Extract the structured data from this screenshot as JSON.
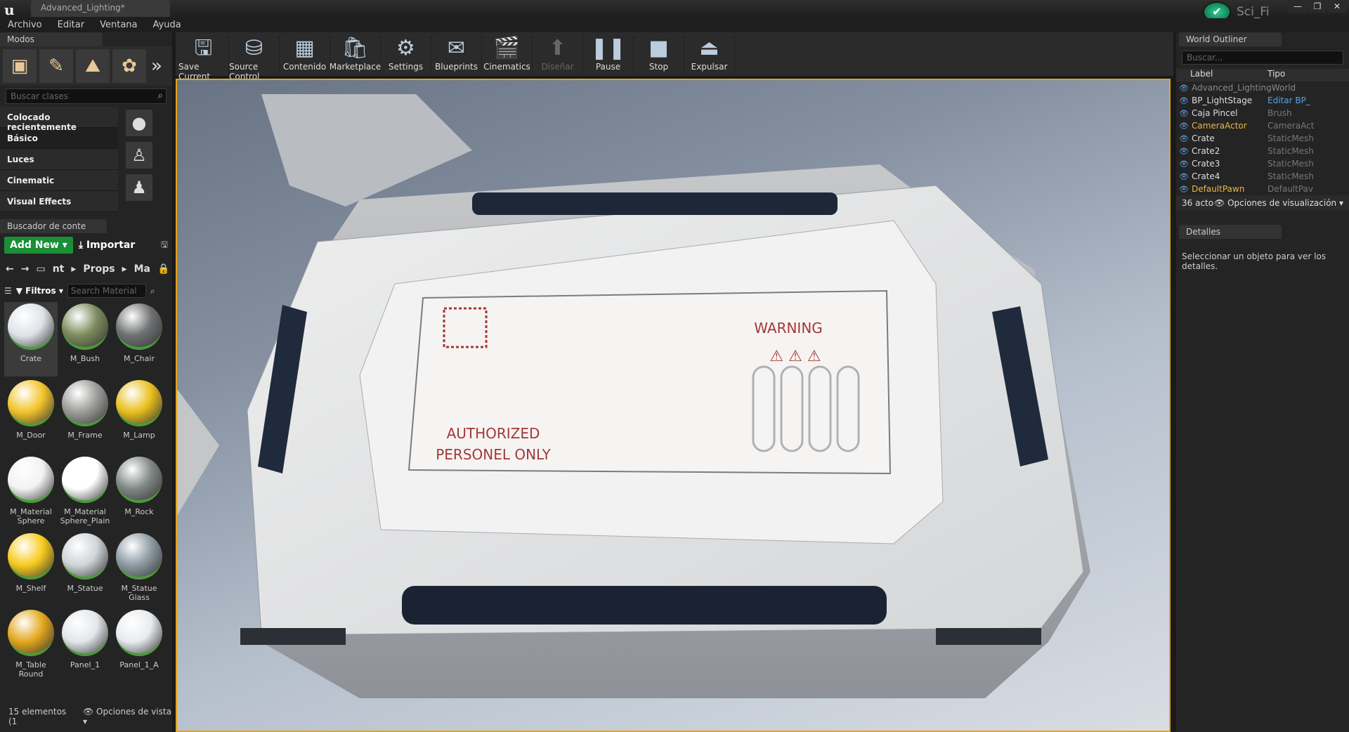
{
  "window": {
    "tab_title": "Advanced_Lighting*",
    "project_name": "Sci_Fi",
    "controls": [
      "—",
      "❐",
      "✕"
    ]
  },
  "menu": [
    "Archivo",
    "Editar",
    "Ventana",
    "Ayuda"
  ],
  "modes": {
    "tab_label": "Modos",
    "search_placeholder": "Buscar clases",
    "categories": [
      "Colocado recientemente",
      "Básico",
      "Luces",
      "Cinematic",
      "Visual Effects"
    ]
  },
  "content_browser": {
    "tab_label": "Buscador de conte",
    "add_new_label": "Add New",
    "import_label": "Importar",
    "path": [
      "nt",
      "Props",
      "Ma"
    ],
    "filter_label": "Filtros",
    "search_placeholder": "Search Material",
    "assets": [
      {
        "label": "Crate",
        "color": "#dfe3e8"
      },
      {
        "label": "M_Bush",
        "color": "#7c8b5c"
      },
      {
        "label": "M_Chair",
        "color": "#6e7072"
      },
      {
        "label": "M_Door",
        "color": "#f2c42a"
      },
      {
        "label": "M_Frame",
        "color": "#9c9c9a"
      },
      {
        "label": "M_Lamp",
        "color": "#e9bf1c"
      },
      {
        "label": "M_Material Sphere",
        "color": "#f2f2f2"
      },
      {
        "label": "M_Material Sphere_Plain",
        "color": "#ffffff"
      },
      {
        "label": "M_Rock",
        "color": "#808886"
      },
      {
        "label": "M_Shelf",
        "color": "#f7cb1d"
      },
      {
        "label": "M_Statue",
        "color": "#cfd4d8"
      },
      {
        "label": "M_Statue Glass",
        "color": "#8d9ba3"
      },
      {
        "label": "M_Table Round",
        "color": "#e2a61c"
      },
      {
        "label": "Panel_1",
        "color": "#e3e6ea"
      },
      {
        "label": "Panel_1_A",
        "color": "#e8ebee"
      }
    ],
    "footer_count": "15 elementos (1",
    "footer_view": "Opciones de vista"
  },
  "toolbar": [
    {
      "label": "Save Current",
      "icon": "save-icon"
    },
    {
      "label": "Source Control",
      "icon": "source-control-icon"
    },
    {
      "label": "Contenido",
      "icon": "content-icon"
    },
    {
      "label": "Marketplace",
      "icon": "marketplace-icon"
    },
    {
      "label": "Settings",
      "icon": "settings-icon"
    },
    {
      "label": "Blueprints",
      "icon": "blueprints-icon"
    },
    {
      "label": "Cinematics",
      "icon": "cinematics-icon"
    },
    {
      "label": "Diseñar",
      "icon": "build-icon"
    },
    {
      "label": "Pause",
      "icon": "pause-icon"
    },
    {
      "label": "Stop",
      "icon": "stop-icon"
    },
    {
      "label": "Expulsar",
      "icon": "eject-icon"
    }
  ],
  "viewport": {
    "decal_warning": "WARNING",
    "decal_auth_line1": "AUTHORIZED",
    "decal_auth_line2": "PERSONEL ONLY"
  },
  "outliner": {
    "tab_label": "World Outliner",
    "search_placeholder": "Buscar...",
    "col_label": "Label",
    "col_type": "Tipo",
    "rows": [
      {
        "label": "Advanced_LightingWorld",
        "type": "",
        "style": "dimw"
      },
      {
        "label": "BP_LightStage",
        "type": "Editar BP_",
        "style": ""
      },
      {
        "label": "Caja Pincel",
        "type": "Brush",
        "style": ""
      },
      {
        "label": "CameraActor",
        "type": "CameraAct",
        "style": "gold"
      },
      {
        "label": "Crate",
        "type": "StaticMesh",
        "style": ""
      },
      {
        "label": "Crate2",
        "type": "StaticMesh",
        "style": ""
      },
      {
        "label": "Crate3",
        "type": "StaticMesh",
        "style": ""
      },
      {
        "label": "Crate4",
        "type": "StaticMesh",
        "style": ""
      },
      {
        "label": "DefaultPawn",
        "type": "DefaultPav",
        "style": "gold"
      }
    ],
    "footer_count": "36 acto",
    "footer_view": "Opciones de visualización"
  },
  "details": {
    "tab_label": "Detalles",
    "empty_message": "Seleccionar un objeto para ver los detalles."
  }
}
